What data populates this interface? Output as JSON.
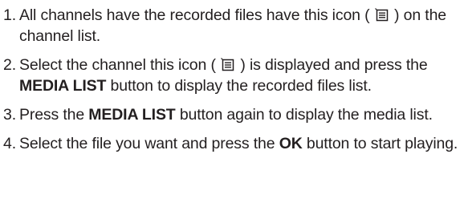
{
  "steps": [
    {
      "number": "1.",
      "parts": {
        "a": "All channels have the recorded files have this icon (",
        "b": ") on the channel list."
      },
      "icon": "media-list-icon"
    },
    {
      "number": "2.",
      "parts": {
        "a": "Select the channel this icon (",
        "b": ") is displayed and press the ",
        "bold": "MEDIA LIST",
        "c": " button to display the recorded files list."
      },
      "icon": "media-list-icon"
    },
    {
      "number": "3.",
      "parts": {
        "a": "Press the ",
        "bold": "MEDIA LIST",
        "b": " button again to display the media list."
      }
    },
    {
      "number": "4.",
      "parts": {
        "a": "Select the file you want and press the ",
        "bold": "OK",
        "b": " button to start playing."
      }
    }
  ],
  "colors": {
    "text": "#231f20",
    "background": "#ffffff"
  }
}
